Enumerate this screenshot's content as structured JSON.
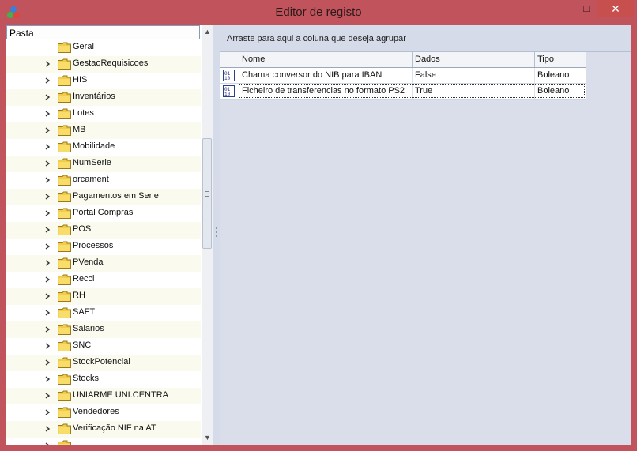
{
  "window": {
    "title": "Editor de registo",
    "minimize": "–",
    "maximize": "□",
    "close": "✕"
  },
  "tree": {
    "header": "Pasta",
    "items": [
      {
        "label": "Geral",
        "expandable": false
      },
      {
        "label": "GestaoRequisicoes",
        "expandable": true
      },
      {
        "label": "HIS",
        "expandable": true
      },
      {
        "label": "Inventários",
        "expandable": true
      },
      {
        "label": "Lotes",
        "expandable": true
      },
      {
        "label": "MB",
        "expandable": true
      },
      {
        "label": "Mobilidade",
        "expandable": true
      },
      {
        "label": "NumSerie",
        "expandable": true
      },
      {
        "label": "orcament",
        "expandable": true
      },
      {
        "label": "Pagamentos em Serie",
        "expandable": true
      },
      {
        "label": "Portal Compras",
        "expandable": true
      },
      {
        "label": "POS",
        "expandable": true
      },
      {
        "label": "Processos",
        "expandable": true
      },
      {
        "label": "PVenda",
        "expandable": true
      },
      {
        "label": "Reccl",
        "expandable": true
      },
      {
        "label": "RH",
        "expandable": true
      },
      {
        "label": "SAFT",
        "expandable": true
      },
      {
        "label": "Salarios",
        "expandable": true
      },
      {
        "label": "SNC",
        "expandable": true
      },
      {
        "label": "StockPotencial",
        "expandable": true
      },
      {
        "label": "Stocks",
        "expandable": true
      },
      {
        "label": "UNIARME UNI.CENTRA",
        "expandable": true
      },
      {
        "label": "Vendedores",
        "expandable": true
      },
      {
        "label": "Verificação NIF na AT",
        "expandable": true
      },
      {
        "label": "",
        "expandable": true
      }
    ]
  },
  "grid": {
    "group_hint": "Arraste para aqui a coluna que deseja agrupar",
    "columns": [
      "Nome",
      "Dados",
      "Tipo"
    ],
    "rows": [
      {
        "nome": "Chama conversor do NIB para IBAN",
        "dados": "False",
        "tipo": "Boleano"
      },
      {
        "nome": "Ficheiro de transferencias no formato PS2",
        "dados": "True",
        "tipo": "Boleano"
      }
    ]
  },
  "colors": {
    "window_frame": "#c0535c",
    "client_bg": "#d6dbe9",
    "tree_alt_row": "#fbfaee",
    "folder": "#f2cc48"
  }
}
